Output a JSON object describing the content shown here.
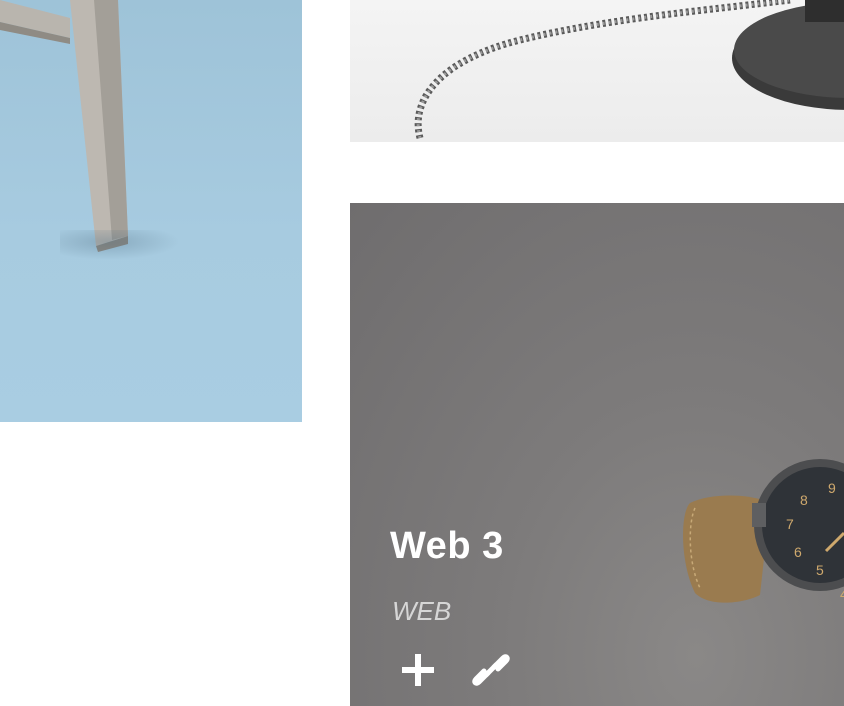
{
  "portfolio": {
    "items": [
      {
        "image": "chair-leg-on-blue"
      },
      {
        "image": "braided-cable-lamp-base"
      },
      {
        "image": "wrist-watch",
        "title": "Web 3",
        "category": "WEB",
        "actions": [
          {
            "icon": "plus-icon"
          },
          {
            "icon": "link-icon"
          }
        ]
      }
    ]
  },
  "colors": {
    "overlay": "#6f6d6e",
    "title": "#ffffff",
    "category": "#d6d6d6",
    "left_bg": "#a7cbe0"
  }
}
